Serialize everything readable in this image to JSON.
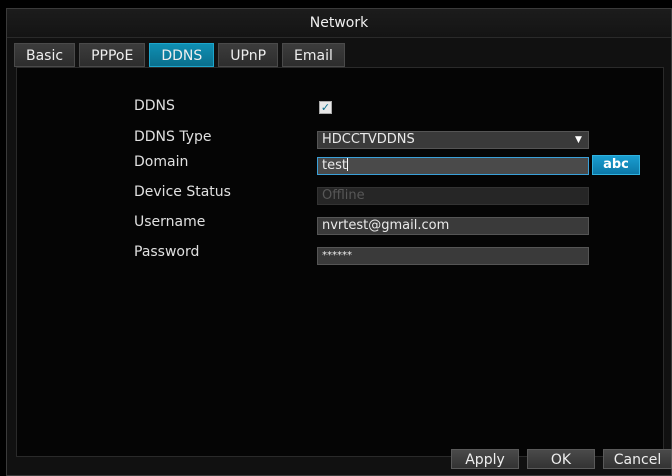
{
  "window": {
    "title": "Network"
  },
  "tabs": [
    {
      "label": "Basic"
    },
    {
      "label": "PPPoE"
    },
    {
      "label": "DDNS",
      "active": true
    },
    {
      "label": "UPnP"
    },
    {
      "label": "Email"
    }
  ],
  "form": {
    "ddns": {
      "label": "DDNS",
      "checked": true,
      "check_glyph": "✓"
    },
    "ddns_type": {
      "label": "DDNS Type",
      "value": "HDCCTVDDNS",
      "arrow": "▼"
    },
    "domain": {
      "label": "Domain",
      "value": "test",
      "keyboard_button": "abc"
    },
    "device_status": {
      "label": "Device Status",
      "value": "Offline"
    },
    "username": {
      "label": "Username",
      "value": "nvrtest@gmail.com"
    },
    "password": {
      "label": "Password",
      "value": "******"
    }
  },
  "buttons": {
    "apply": "Apply",
    "ok": "OK",
    "cancel": "Cancel"
  },
  "colors": {
    "accent": "#0a6f8d",
    "background": "#050505"
  }
}
